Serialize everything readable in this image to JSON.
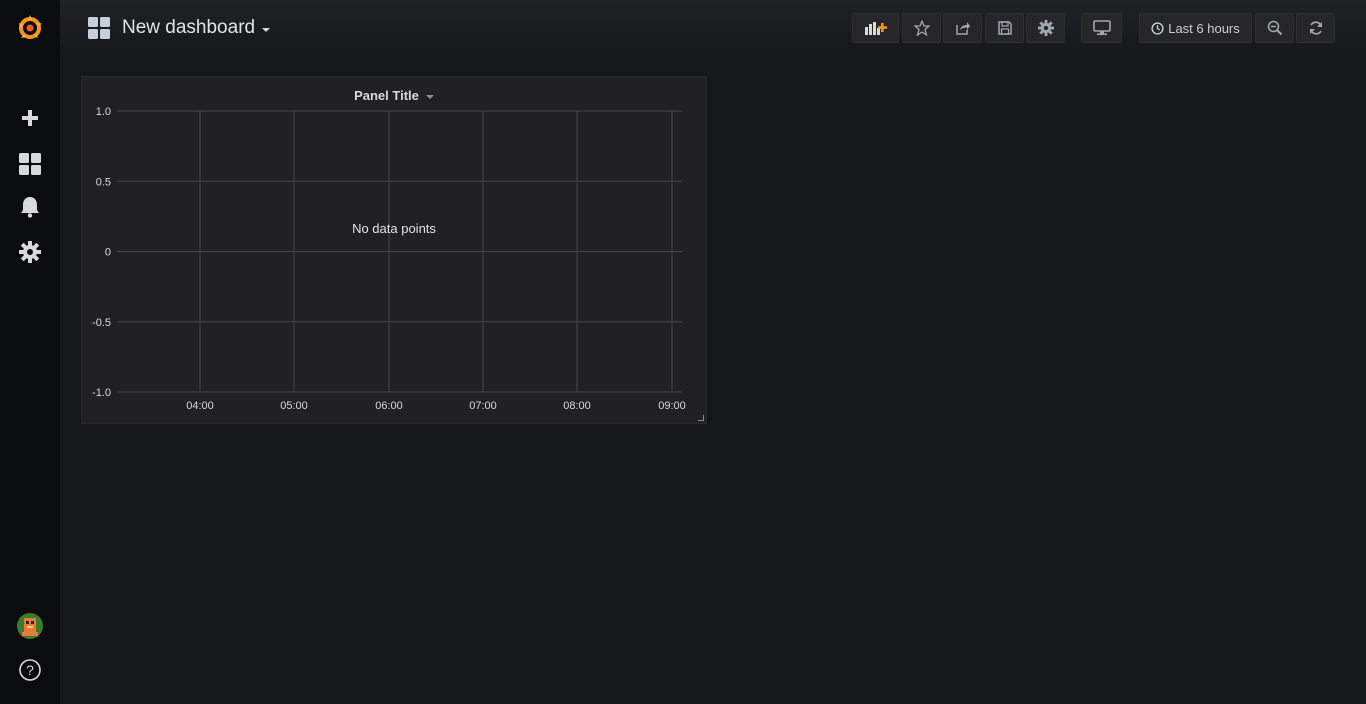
{
  "sidebar": {
    "items": [
      {
        "icon": "grafana-logo-icon"
      },
      {
        "icon": "plus-icon"
      },
      {
        "icon": "dashboards-icon"
      },
      {
        "icon": "bell-icon"
      },
      {
        "icon": "gear-icon"
      },
      {
        "icon": "user-avatar"
      },
      {
        "icon": "help-icon"
      }
    ]
  },
  "header": {
    "dashboard_title": "New dashboard",
    "time_range_label": "Last 6 hours",
    "buttons": [
      "add-panel-icon",
      "star-icon",
      "share-icon",
      "save-icon",
      "settings-icon",
      "tv-monitor-icon",
      "clock-icon",
      "zoom-out-icon",
      "refresh-icon"
    ]
  },
  "panel": {
    "title": "Panel Title",
    "no_data_text": "No data points"
  },
  "colors": {
    "brand_orange": "#f7941e",
    "background": "#161719",
    "panel_bg": "#212124",
    "sidebar_bg": "#0b0c0e",
    "grid": "#464646"
  },
  "chart_data": {
    "type": "line",
    "title": "Panel Title",
    "series": [],
    "x_ticks": [
      "04:00",
      "05:00",
      "06:00",
      "07:00",
      "08:00",
      "09:00"
    ],
    "y_ticks": [
      "1.0",
      "0.5",
      "0",
      "-0.5",
      "-1.0"
    ],
    "ylim": [
      -1.0,
      1.0
    ],
    "grid": true,
    "annotation": "No data points"
  }
}
